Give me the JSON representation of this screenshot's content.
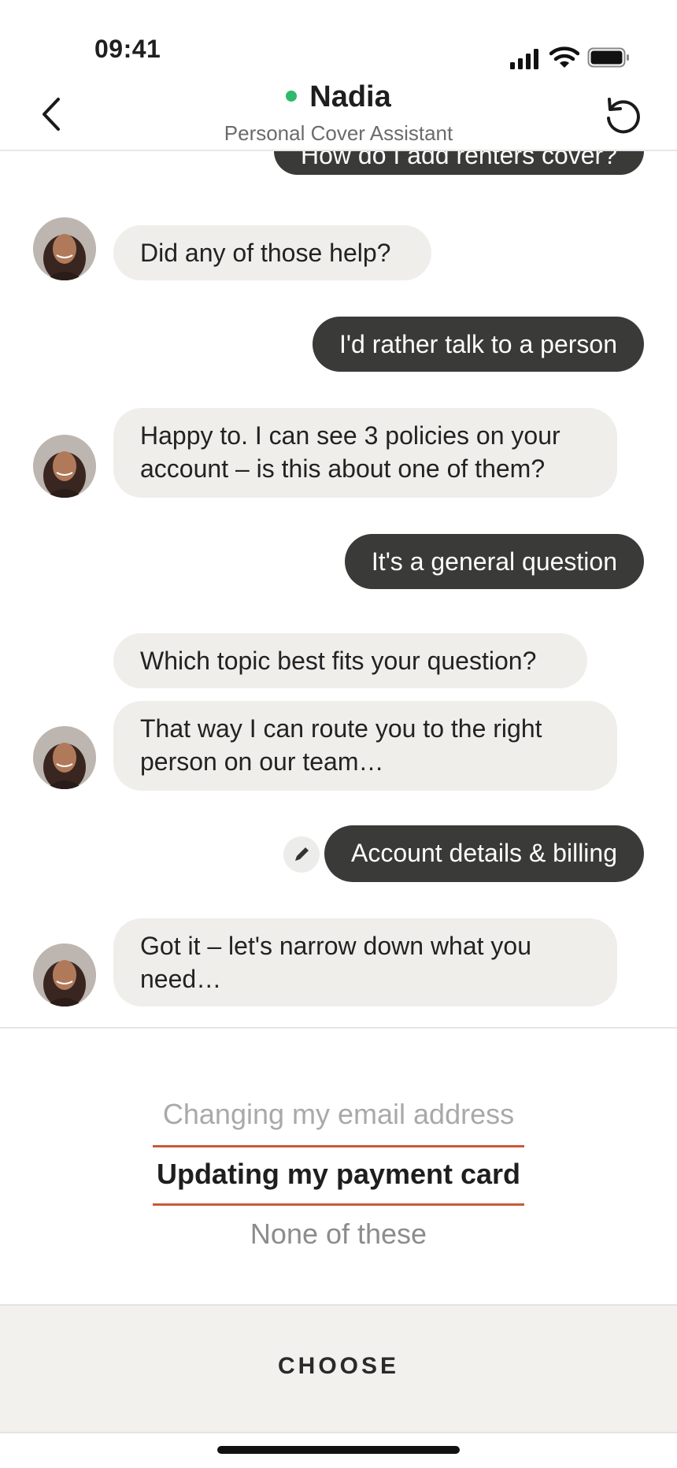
{
  "status": {
    "time": "09:41"
  },
  "header": {
    "name": "Nadia",
    "subtitle": "Personal Cover Assistant"
  },
  "messages": [
    {
      "from": "user",
      "text": "How do I add renters cover?"
    },
    {
      "from": "bot",
      "text": "Did any of those help?"
    },
    {
      "from": "user",
      "text": "I'd rather talk to a person"
    },
    {
      "from": "bot",
      "text": "Happy to. I can see 3 policies on your account – is this about one of them?"
    },
    {
      "from": "user",
      "text": "It's a general question"
    },
    {
      "from": "bot",
      "text": "Which topic best fits your question?"
    },
    {
      "from": "bot",
      "text": "That way I can route you to the right person on our team…"
    },
    {
      "from": "user",
      "text": "Account details & billing"
    },
    {
      "from": "bot",
      "text": "Got it – let's narrow down what you need…"
    }
  ],
  "picker": {
    "options": [
      "Changing my email address",
      "Updating my payment card",
      "None of these"
    ],
    "selected": "Updating my payment card"
  },
  "actions": {
    "choose_label": "CHOOSE"
  },
  "colors": {
    "online": "#2fb96b",
    "user_bubble": "#3a3a38",
    "bot_bubble": "#efeeeb",
    "selection_accent": "#c85a3a"
  },
  "icons": {
    "back": "chevron-left-icon",
    "refresh": "refresh-icon",
    "edit": "pencil-icon"
  }
}
